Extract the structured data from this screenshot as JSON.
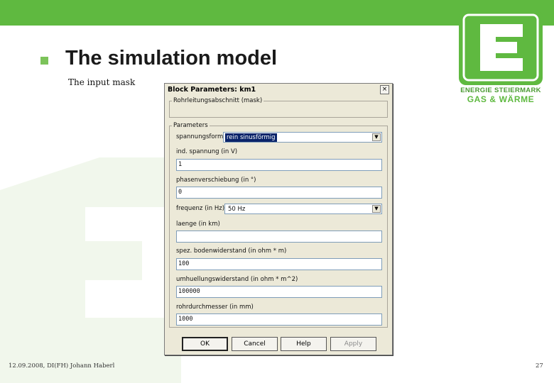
{
  "slide": {
    "title": "The simulation model",
    "subtitle": "The input mask",
    "footer_left": "12.09.2008, DI(FH) Johann Haberl",
    "page_number": "27"
  },
  "logo": {
    "letter": "E",
    "line1": "ENERGIE STEIERMARK",
    "line2": "GAS & WÄRME"
  },
  "colors": {
    "brand_green": "#5fb940",
    "dialog_bg": "#ece9d8",
    "selection": "#0a246a"
  },
  "dialog": {
    "title": "Block Parameters: km1",
    "close_glyph": "×",
    "mask_group_label": "Rohrleitungsabschnitt (mask)",
    "params_group_label": "Parameters",
    "fields": [
      {
        "label": "spannungsform",
        "type": "select",
        "value": "rein sinusförmig"
      },
      {
        "label": "ind. spannung (in V)",
        "type": "text",
        "value": "1"
      },
      {
        "label": "phasenverschiebung (in °)",
        "type": "text",
        "value": "0"
      },
      {
        "label": "frequenz (in Hz)",
        "type": "select",
        "value": "50 Hz"
      },
      {
        "label": "laenge (in km)",
        "type": "text",
        "value": ""
      },
      {
        "label": "spez. bodenwiderstand (in ohm * m)",
        "type": "text",
        "value": "100"
      },
      {
        "label": "umhuellungswiderstand (in ohm * m^2)",
        "type": "text",
        "value": "100000"
      },
      {
        "label": "rohrdurchmesser (in mm)",
        "type": "text",
        "value": "1000"
      }
    ],
    "buttons": {
      "ok": "OK",
      "cancel": "Cancel",
      "help": "Help",
      "apply": "Apply"
    }
  }
}
